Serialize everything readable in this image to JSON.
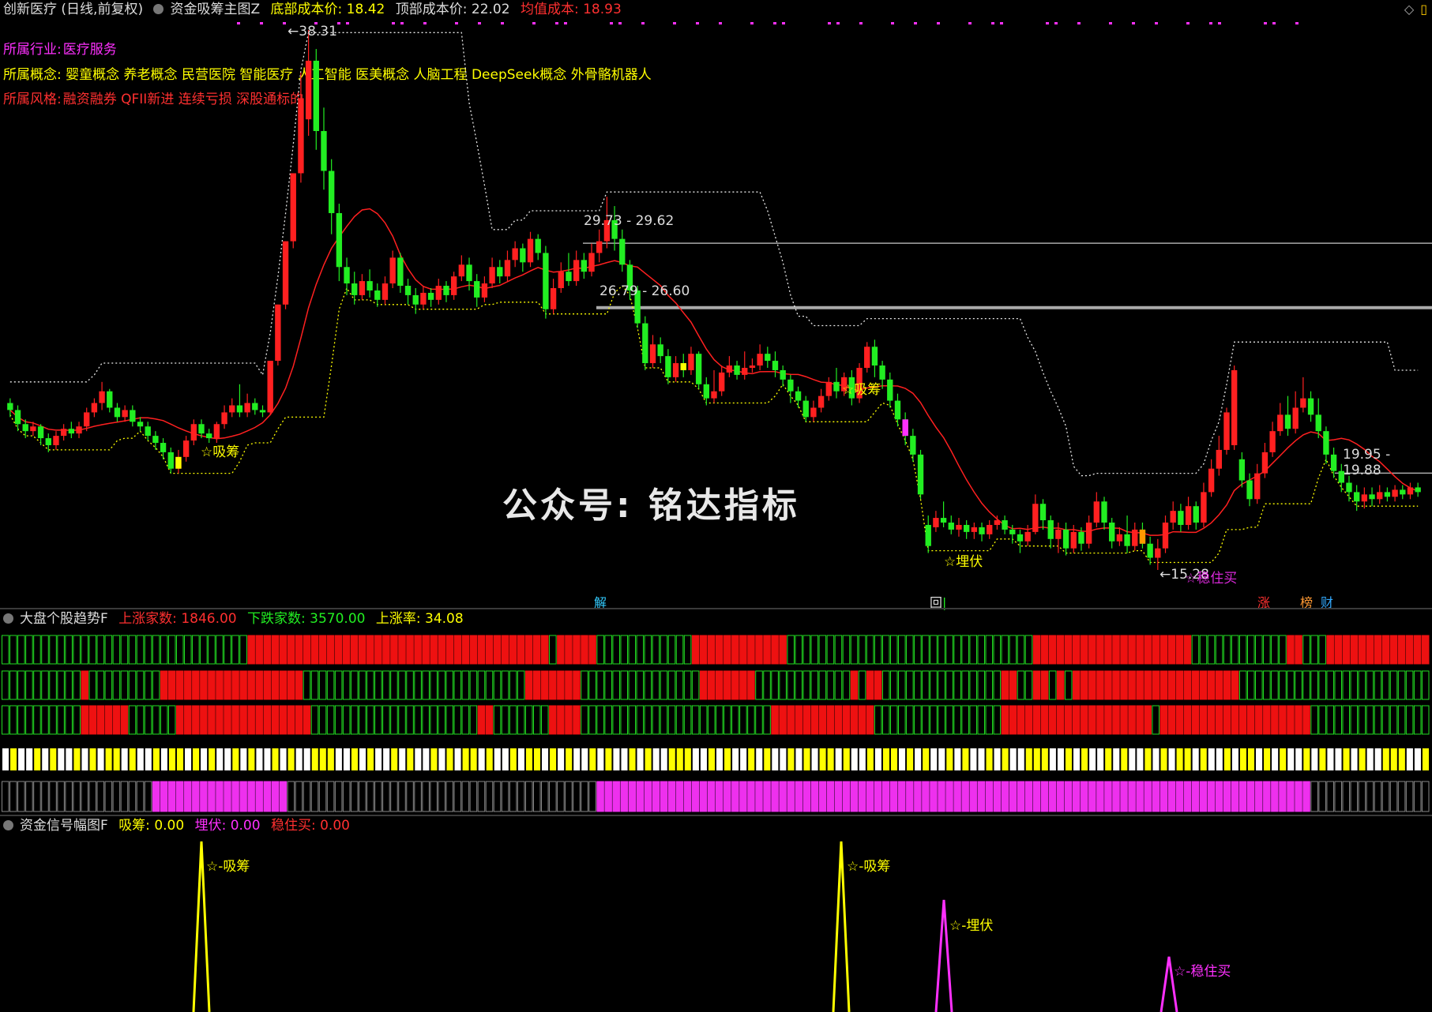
{
  "header": {
    "stock_title": "创新医疗 (日线,前复权)",
    "indicator_name": "资金吸筹主图Z",
    "bottom_cost_label": "底部成本价: 18.42",
    "top_cost_label": "顶部成本价: 22.02",
    "avg_cost_label": "均值成本: 18.93",
    "colors": {
      "white": "#dddddd",
      "yellow": "#ffff00",
      "red": "#ff3030",
      "magenta": "#ff30ff",
      "green": "#22ee22"
    }
  },
  "info": {
    "industry_label": "所属行业:",
    "industry_value": "医疗服务",
    "concept_line": "所属概念: 婴童概念 养老概念 民营医院 智能医疗 人工智能 医美概念 人脑工程 DeepSeek概念 外骨骼机器人",
    "style_label": "所属风格:",
    "style_value": "融资融券 QFII新进 连续亏损 深股通标的"
  },
  "main_chart": {
    "price_annotations": {
      "high": "38.31",
      "low": "15.28",
      "range1": "29.73 - 29.62",
      "range2": "26.79 - 26.60",
      "range3": "19.95 - 19.88"
    },
    "signal_labels": {
      "xichou": "☆吸筹",
      "maifu": "☆埋伏",
      "wenzhumai": "☆稳住买"
    },
    "event_tags": [
      "解",
      "回",
      "涨",
      "榜",
      "财"
    ],
    "watermark": "公众号: 铭达指标"
  },
  "panel2": {
    "title": "大盘个股趋势F",
    "up_label": "上涨家数: 1846.00",
    "down_label": "下跌家数: 3570.00",
    "rate_label": "上涨率: 34.08"
  },
  "panel3": {
    "title": "资金信号幅图F",
    "xichou_label": "吸筹: 0.00",
    "maifu_label": "埋伏: 0.00",
    "wenzhumai_label": "稳住买: 0.00",
    "peak_labels": {
      "xichou": "☆-吸筹",
      "maifu": "☆-埋伏",
      "wenzhumai": "☆-稳住买"
    }
  },
  "chart_data": {
    "type": "candlestick",
    "price_range": [
      15.28,
      38.31
    ],
    "bars": [
      {
        "o": 22.4,
        "c": 22.1,
        "h": 22.6,
        "l": 21.8
      },
      {
        "o": 22.1,
        "c": 21.5,
        "h": 22.3,
        "l": 21.2
      },
      {
        "o": 21.5,
        "c": 21.2,
        "h": 21.7,
        "l": 20.9
      },
      {
        "o": 21.2,
        "c": 21.4,
        "h": 21.6,
        "l": 21.0
      },
      {
        "o": 21.4,
        "c": 20.9,
        "h": 21.5,
        "l": 20.6
      },
      {
        "o": 20.9,
        "c": 20.6,
        "h": 21.1,
        "l": 20.3
      },
      {
        "o": 20.6,
        "c": 21.0,
        "h": 21.2,
        "l": 20.4
      },
      {
        "o": 21.0,
        "c": 21.3,
        "h": 21.5,
        "l": 20.8
      },
      {
        "o": 21.3,
        "c": 21.1,
        "h": 21.6,
        "l": 20.9
      },
      {
        "o": 21.1,
        "c": 21.4,
        "h": 21.6,
        "l": 20.9
      },
      {
        "o": 21.4,
        "c": 22.0,
        "h": 22.2,
        "l": 21.2
      },
      {
        "o": 22.0,
        "c": 22.4,
        "h": 22.6,
        "l": 21.8
      },
      {
        "o": 22.4,
        "c": 22.9,
        "h": 23.3,
        "l": 22.1
      },
      {
        "o": 22.9,
        "c": 22.2,
        "h": 23.0,
        "l": 22.0
      },
      {
        "o": 22.2,
        "c": 21.8,
        "h": 22.4,
        "l": 21.6
      },
      {
        "o": 21.8,
        "c": 22.1,
        "h": 22.3,
        "l": 21.6
      },
      {
        "o": 22.1,
        "c": 21.6,
        "h": 22.3,
        "l": 21.4
      },
      {
        "o": 21.6,
        "c": 21.4,
        "h": 21.8,
        "l": 21.2
      },
      {
        "o": 21.4,
        "c": 21.0,
        "h": 21.6,
        "l": 20.8
      },
      {
        "o": 21.0,
        "c": 20.7,
        "h": 21.2,
        "l": 20.4
      },
      {
        "o": 20.7,
        "c": 20.3,
        "h": 20.9,
        "l": 20.0
      },
      {
        "o": 20.3,
        "c": 19.6,
        "h": 20.5,
        "l": 19.4
      },
      {
        "o": 19.6,
        "c": 20.1,
        "h": 20.4,
        "l": 19.4
      },
      {
        "o": 20.1,
        "c": 20.8,
        "h": 21.0,
        "l": 19.9
      },
      {
        "o": 20.8,
        "c": 21.5,
        "h": 21.7,
        "l": 20.6
      },
      {
        "o": 21.5,
        "c": 21.1,
        "h": 21.7,
        "l": 20.9
      },
      {
        "o": 21.1,
        "c": 20.9,
        "h": 21.3,
        "l": 20.7
      },
      {
        "o": 20.9,
        "c": 21.5,
        "h": 21.6,
        "l": 20.7
      },
      {
        "o": 21.5,
        "c": 22.0,
        "h": 22.3,
        "l": 21.3
      },
      {
        "o": 22.0,
        "c": 22.3,
        "h": 22.6,
        "l": 21.8
      },
      {
        "o": 22.3,
        "c": 22.0,
        "h": 23.2,
        "l": 21.8
      },
      {
        "o": 22.0,
        "c": 22.4,
        "h": 22.8,
        "l": 21.8
      },
      {
        "o": 22.4,
        "c": 22.1,
        "h": 22.6,
        "l": 21.9
      },
      {
        "o": 22.1,
        "c": 22.0,
        "h": 22.3,
        "l": 21.8
      },
      {
        "o": 22.0,
        "c": 24.2,
        "h": 24.2,
        "l": 21.9
      },
      {
        "o": 24.2,
        "c": 26.6,
        "h": 26.6,
        "l": 24.0
      },
      {
        "o": 26.6,
        "c": 29.3,
        "h": 29.3,
        "l": 26.4
      },
      {
        "o": 29.3,
        "c": 32.2,
        "h": 32.2,
        "l": 29.0
      },
      {
        "o": 32.2,
        "c": 35.4,
        "h": 36.5,
        "l": 31.8
      },
      {
        "o": 34.5,
        "c": 37.0,
        "h": 38.31,
        "l": 33.8
      },
      {
        "o": 37.0,
        "c": 34.0,
        "h": 37.5,
        "l": 33.2
      },
      {
        "o": 34.0,
        "c": 32.3,
        "h": 35.0,
        "l": 31.5
      },
      {
        "o": 32.3,
        "c": 30.5,
        "h": 32.8,
        "l": 29.6
      },
      {
        "o": 30.5,
        "c": 28.2,
        "h": 30.9,
        "l": 27.6
      },
      {
        "o": 28.2,
        "c": 27.5,
        "h": 28.6,
        "l": 27.0
      },
      {
        "o": 27.5,
        "c": 27.0,
        "h": 28.0,
        "l": 26.6
      },
      {
        "o": 27.0,
        "c": 27.6,
        "h": 27.9,
        "l": 26.8
      },
      {
        "o": 27.6,
        "c": 27.2,
        "h": 28.1,
        "l": 26.9
      },
      {
        "o": 27.2,
        "c": 26.8,
        "h": 27.5,
        "l": 26.5
      },
      {
        "o": 26.8,
        "c": 27.5,
        "h": 27.8,
        "l": 26.6
      },
      {
        "o": 27.5,
        "c": 28.6,
        "h": 28.9,
        "l": 27.3
      },
      {
        "o": 28.6,
        "c": 27.4,
        "h": 28.8,
        "l": 27.1
      },
      {
        "o": 27.4,
        "c": 27.0,
        "h": 27.7,
        "l": 26.6
      },
      {
        "o": 27.0,
        "c": 26.6,
        "h": 27.3,
        "l": 26.2
      },
      {
        "o": 26.6,
        "c": 27.1,
        "h": 27.4,
        "l": 26.4
      },
      {
        "o": 27.1,
        "c": 26.8,
        "h": 27.3,
        "l": 26.5
      },
      {
        "o": 26.8,
        "c": 27.4,
        "h": 27.7,
        "l": 26.6
      },
      {
        "o": 27.4,
        "c": 27.0,
        "h": 27.6,
        "l": 26.7
      },
      {
        "o": 27.0,
        "c": 27.8,
        "h": 28.0,
        "l": 26.8
      },
      {
        "o": 27.8,
        "c": 28.3,
        "h": 28.7,
        "l": 27.6
      },
      {
        "o": 28.3,
        "c": 27.6,
        "h": 28.6,
        "l": 27.2
      },
      {
        "o": 27.6,
        "c": 26.9,
        "h": 27.9,
        "l": 26.5
      },
      {
        "o": 26.9,
        "c": 27.5,
        "h": 27.8,
        "l": 26.7
      },
      {
        "o": 27.5,
        "c": 28.2,
        "h": 28.6,
        "l": 27.3
      },
      {
        "o": 28.2,
        "c": 27.8,
        "h": 28.5,
        "l": 27.5
      },
      {
        "o": 27.8,
        "c": 28.5,
        "h": 28.9,
        "l": 27.6
      },
      {
        "o": 28.5,
        "c": 29.0,
        "h": 29.3,
        "l": 28.2
      },
      {
        "o": 29.0,
        "c": 28.4,
        "h": 29.2,
        "l": 28.0
      },
      {
        "o": 28.4,
        "c": 29.4,
        "h": 29.7,
        "l": 28.2
      },
      {
        "o": 29.4,
        "c": 28.8,
        "h": 29.6,
        "l": 28.5
      },
      {
        "o": 28.8,
        "c": 26.4,
        "h": 29.1,
        "l": 26.0
      },
      {
        "o": 26.4,
        "c": 27.3,
        "h": 27.7,
        "l": 26.2
      },
      {
        "o": 27.3,
        "c": 28.0,
        "h": 28.4,
        "l": 27.1
      },
      {
        "o": 28.0,
        "c": 27.6,
        "h": 28.8,
        "l": 27.4
      },
      {
        "o": 27.6,
        "c": 28.5,
        "h": 28.9,
        "l": 27.4
      },
      {
        "o": 28.5,
        "c": 28.0,
        "h": 28.8,
        "l": 27.7
      },
      {
        "o": 28.0,
        "c": 28.8,
        "h": 29.2,
        "l": 27.8
      },
      {
        "o": 28.8,
        "c": 29.3,
        "h": 29.8,
        "l": 28.4
      },
      {
        "o": 29.3,
        "c": 30.2,
        "h": 31.2,
        "l": 29.0
      },
      {
        "o": 30.2,
        "c": 29.4,
        "h": 30.8,
        "l": 28.9
      },
      {
        "o": 29.4,
        "c": 28.3,
        "h": 29.8,
        "l": 28.0
      },
      {
        "o": 28.3,
        "c": 27.2,
        "h": 28.5,
        "l": 26.8
      },
      {
        "o": 27.2,
        "c": 25.8,
        "h": 27.4,
        "l": 25.6
      },
      {
        "o": 25.8,
        "c": 24.1,
        "h": 26.1,
        "l": 23.8
      },
      {
        "o": 24.1,
        "c": 24.9,
        "h": 25.3,
        "l": 23.9
      },
      {
        "o": 24.9,
        "c": 24.4,
        "h": 25.2,
        "l": 24.1
      },
      {
        "o": 24.4,
        "c": 23.5,
        "h": 24.7,
        "l": 23.2
      },
      {
        "o": 23.5,
        "c": 24.1,
        "h": 24.4,
        "l": 23.3
      },
      {
        "o": 24.1,
        "c": 23.8,
        "h": 24.5,
        "l": 23.5
      },
      {
        "o": 23.8,
        "c": 24.5,
        "h": 24.8,
        "l": 23.6
      },
      {
        "o": 24.5,
        "c": 23.2,
        "h": 24.6,
        "l": 23.0
      },
      {
        "o": 23.2,
        "c": 22.6,
        "h": 23.5,
        "l": 22.3
      },
      {
        "o": 22.6,
        "c": 22.9,
        "h": 23.8,
        "l": 22.4
      },
      {
        "o": 22.9,
        "c": 23.7,
        "h": 24.0,
        "l": 22.7
      },
      {
        "o": 23.7,
        "c": 24.0,
        "h": 24.4,
        "l": 23.5
      },
      {
        "o": 24.0,
        "c": 23.6,
        "h": 24.2,
        "l": 23.4
      },
      {
        "o": 23.6,
        "c": 23.9,
        "h": 24.6,
        "l": 23.4
      },
      {
        "o": 23.9,
        "c": 24.0,
        "h": 24.3,
        "l": 23.7
      },
      {
        "o": 24.0,
        "c": 24.5,
        "h": 24.9,
        "l": 23.8
      },
      {
        "o": 24.5,
        "c": 24.2,
        "h": 24.8,
        "l": 23.9
      },
      {
        "o": 24.2,
        "c": 23.8,
        "h": 24.6,
        "l": 23.5
      },
      {
        "o": 23.8,
        "c": 23.4,
        "h": 24.0,
        "l": 23.1
      },
      {
        "o": 23.4,
        "c": 22.9,
        "h": 23.6,
        "l": 22.4
      },
      {
        "o": 22.9,
        "c": 22.5,
        "h": 23.1,
        "l": 22.2
      },
      {
        "o": 22.5,
        "c": 21.8,
        "h": 22.7,
        "l": 21.6
      },
      {
        "o": 21.8,
        "c": 22.2,
        "h": 22.5,
        "l": 21.6
      },
      {
        "o": 22.2,
        "c": 22.7,
        "h": 23.0,
        "l": 22.0
      },
      {
        "o": 22.7,
        "c": 23.3,
        "h": 23.5,
        "l": 22.5
      },
      {
        "o": 23.3,
        "c": 22.9,
        "h": 23.9,
        "l": 22.6
      },
      {
        "o": 22.9,
        "c": 23.5,
        "h": 23.7,
        "l": 22.7
      },
      {
        "o": 23.5,
        "c": 22.6,
        "h": 23.8,
        "l": 22.3
      },
      {
        "o": 22.6,
        "c": 23.9,
        "h": 24.1,
        "l": 22.4
      },
      {
        "o": 23.9,
        "c": 24.8,
        "h": 25.0,
        "l": 23.7
      },
      {
        "o": 24.8,
        "c": 24.0,
        "h": 25.1,
        "l": 23.5
      },
      {
        "o": 24.0,
        "c": 23.4,
        "h": 24.2,
        "l": 23.0
      },
      {
        "o": 23.4,
        "c": 22.5,
        "h": 23.7,
        "l": 22.2
      },
      {
        "o": 22.5,
        "c": 21.7,
        "h": 22.8,
        "l": 21.4
      },
      {
        "o": 21.7,
        "c": 21.0,
        "h": 22.0,
        "l": 20.6
      },
      {
        "o": 21.0,
        "c": 20.2,
        "h": 21.3,
        "l": 19.9
      },
      {
        "o": 20.2,
        "c": 18.5,
        "h": 20.4,
        "l": 18.3
      },
      {
        "o": 17.2,
        "c": 16.3,
        "h": 17.6,
        "l": 16.0
      },
      {
        "o": 17.1,
        "c": 17.5,
        "h": 17.8,
        "l": 16.9
      },
      {
        "o": 17.5,
        "c": 17.3,
        "h": 18.2,
        "l": 17.1
      },
      {
        "o": 17.3,
        "c": 17.0,
        "h": 17.6,
        "l": 16.8
      },
      {
        "o": 17.0,
        "c": 17.2,
        "h": 17.5,
        "l": 16.7
      },
      {
        "o": 17.2,
        "c": 16.9,
        "h": 17.4,
        "l": 16.6
      },
      {
        "o": 16.9,
        "c": 17.1,
        "h": 17.3,
        "l": 16.6
      },
      {
        "o": 17.1,
        "c": 16.8,
        "h": 17.3,
        "l": 16.5
      },
      {
        "o": 16.8,
        "c": 17.2,
        "h": 17.4,
        "l": 16.6
      },
      {
        "o": 17.2,
        "c": 17.4,
        "h": 17.6,
        "l": 17.0
      },
      {
        "o": 17.4,
        "c": 17.0,
        "h": 17.6,
        "l": 16.8
      },
      {
        "o": 17.0,
        "c": 16.8,
        "h": 17.2,
        "l": 16.4
      },
      {
        "o": 16.8,
        "c": 16.5,
        "h": 17.0,
        "l": 16.0
      },
      {
        "o": 16.5,
        "c": 16.9,
        "h": 17.2,
        "l": 16.3
      },
      {
        "o": 16.9,
        "c": 18.1,
        "h": 18.5,
        "l": 16.8
      },
      {
        "o": 18.1,
        "c": 17.4,
        "h": 18.3,
        "l": 17.0
      },
      {
        "o": 17.4,
        "c": 16.6,
        "h": 17.6,
        "l": 16.2
      },
      {
        "o": 16.6,
        "c": 17.0,
        "h": 17.3,
        "l": 16.0
      },
      {
        "o": 17.0,
        "c": 16.2,
        "h": 17.3,
        "l": 15.9
      },
      {
        "o": 16.2,
        "c": 16.9,
        "h": 17.2,
        "l": 16.0
      },
      {
        "o": 16.9,
        "c": 16.4,
        "h": 17.1,
        "l": 16.1
      },
      {
        "o": 16.4,
        "c": 17.3,
        "h": 17.6,
        "l": 16.2
      },
      {
        "o": 17.3,
        "c": 18.2,
        "h": 18.6,
        "l": 17.1
      },
      {
        "o": 18.2,
        "c": 17.3,
        "h": 18.4,
        "l": 17.0
      },
      {
        "o": 17.3,
        "c": 16.5,
        "h": 17.5,
        "l": 16.2
      },
      {
        "o": 16.5,
        "c": 16.8,
        "h": 17.1,
        "l": 16.3
      },
      {
        "o": 16.8,
        "c": 16.3,
        "h": 17.6,
        "l": 16.0
      },
      {
        "o": 16.3,
        "c": 17.0,
        "h": 17.3,
        "l": 16.1
      },
      {
        "o": 17.0,
        "c": 16.4,
        "h": 17.3,
        "l": 16.2
      },
      {
        "o": 16.4,
        "c": 15.8,
        "h": 16.7,
        "l": 15.5
      },
      {
        "o": 15.8,
        "c": 16.2,
        "h": 16.6,
        "l": 15.28
      },
      {
        "o": 16.2,
        "c": 17.3,
        "h": 17.6,
        "l": 16.0
      },
      {
        "o": 17.3,
        "c": 17.8,
        "h": 18.2,
        "l": 17.0
      },
      {
        "o": 17.8,
        "c": 17.2,
        "h": 18.1,
        "l": 16.9
      },
      {
        "o": 17.2,
        "c": 18.0,
        "h": 18.4,
        "l": 17.0
      },
      {
        "o": 18.0,
        "c": 17.3,
        "h": 18.2,
        "l": 17.0
      },
      {
        "o": 17.3,
        "c": 18.6,
        "h": 19.0,
        "l": 17.1
      },
      {
        "o": 18.6,
        "c": 19.6,
        "h": 20.0,
        "l": 18.4
      },
      {
        "o": 19.6,
        "c": 20.4,
        "h": 21.0,
        "l": 19.3
      },
      {
        "o": 20.4,
        "c": 22.0,
        "h": 22.2,
        "l": 20.2
      },
      {
        "o": 20.6,
        "c": 23.8,
        "h": 24.0,
        "l": 20.4
      },
      {
        "o": 20.0,
        "c": 19.1,
        "h": 20.3,
        "l": 18.8
      },
      {
        "o": 19.1,
        "c": 18.3,
        "h": 19.4,
        "l": 18.0
      },
      {
        "o": 18.3,
        "c": 19.4,
        "h": 19.8,
        "l": 18.1
      },
      {
        "o": 19.4,
        "c": 20.3,
        "h": 20.7,
        "l": 19.2
      },
      {
        "o": 20.3,
        "c": 21.2,
        "h": 21.6,
        "l": 20.1
      },
      {
        "o": 21.2,
        "c": 21.9,
        "h": 22.4,
        "l": 21.0
      },
      {
        "o": 21.9,
        "c": 21.3,
        "h": 22.7,
        "l": 21.0
      },
      {
        "o": 21.3,
        "c": 22.2,
        "h": 22.9,
        "l": 21.1
      },
      {
        "o": 22.2,
        "c": 22.6,
        "h": 23.5,
        "l": 22.0
      },
      {
        "o": 22.6,
        "c": 21.9,
        "h": 22.9,
        "l": 21.6
      },
      {
        "o": 21.9,
        "c": 21.2,
        "h": 22.6,
        "l": 20.9
      },
      {
        "o": 21.2,
        "c": 20.2,
        "h": 21.4,
        "l": 19.8
      },
      {
        "o": 20.2,
        "c": 19.5,
        "h": 20.5,
        "l": 19.2
      },
      {
        "o": 19.5,
        "c": 19.0,
        "h": 19.8,
        "l": 18.6
      },
      {
        "o": 19.0,
        "c": 18.6,
        "h": 19.3,
        "l": 18.2
      },
      {
        "o": 18.6,
        "c": 18.2,
        "h": 18.9,
        "l": 17.8
      },
      {
        "o": 18.2,
        "c": 18.5,
        "h": 18.8,
        "l": 17.9
      },
      {
        "o": 18.5,
        "c": 18.3,
        "h": 18.8,
        "l": 18.0
      },
      {
        "o": 18.3,
        "c": 18.6,
        "h": 18.9,
        "l": 18.1
      },
      {
        "o": 18.6,
        "c": 18.4,
        "h": 18.8,
        "l": 18.2
      },
      {
        "o": 18.4,
        "c": 18.7,
        "h": 18.9,
        "l": 18.2
      },
      {
        "o": 18.7,
        "c": 18.5,
        "h": 18.9,
        "l": 18.3
      },
      {
        "o": 18.5,
        "c": 18.8,
        "h": 19.0,
        "l": 18.3
      },
      {
        "o": 18.8,
        "c": 18.6,
        "h": 19.0,
        "l": 18.4
      }
    ],
    "overlay_lines": [
      "red moving average",
      "white dotted upper band",
      "yellow dotted lower band"
    ]
  }
}
